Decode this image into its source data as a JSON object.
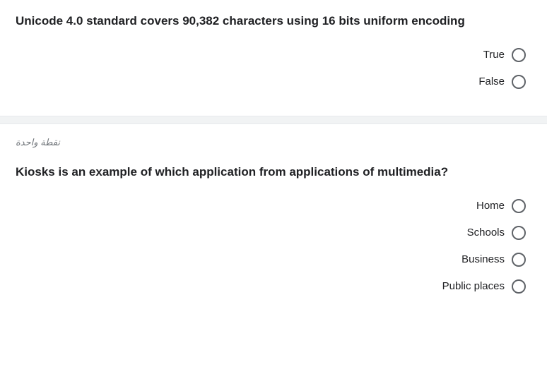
{
  "q1": {
    "text": "Unicode 4.0 standard covers 90,382 characters using 16 bits uniform encoding",
    "options": [
      "True",
      "False"
    ]
  },
  "points_label": "نقطة واحدة",
  "q2": {
    "text": "Kiosks is an example of which application from applications of multimedia?",
    "options": [
      "Home",
      "Schools",
      "Business",
      "Public places"
    ]
  }
}
